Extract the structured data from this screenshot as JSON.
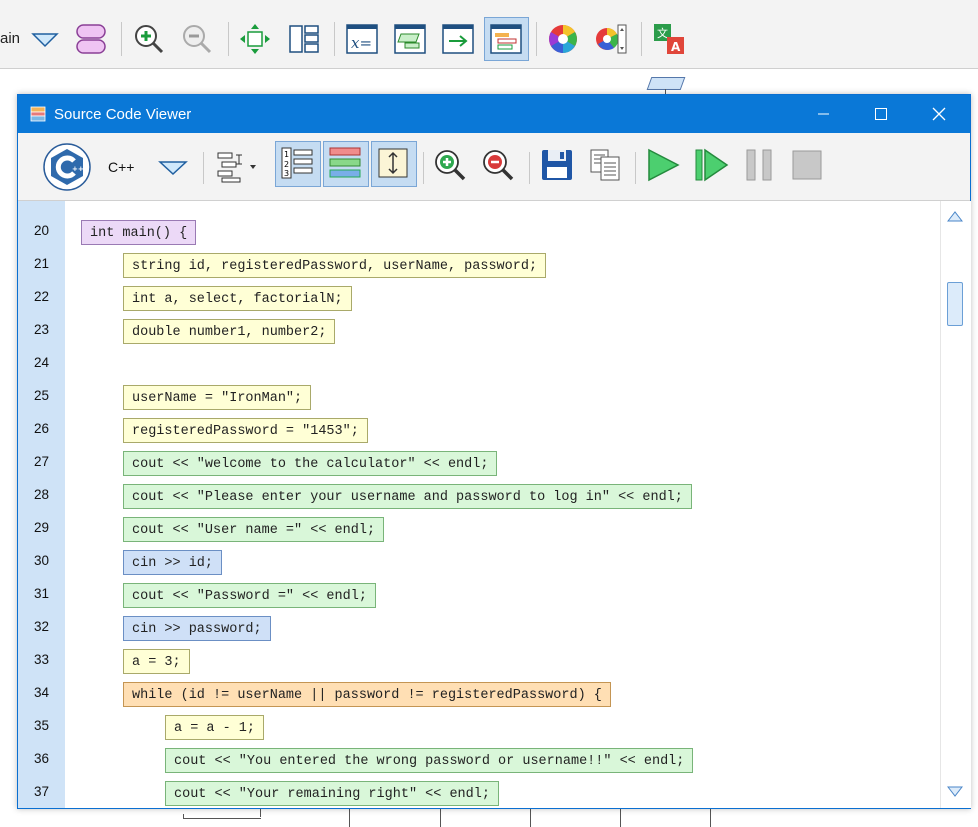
{
  "background": {
    "toolbar_label": "ain",
    "icons": [
      "dropdown-arrow-icon",
      "shape-icon",
      "zoom-in-icon",
      "zoom-out-icon",
      "fit-icon",
      "layout-icon",
      "variable-icon",
      "process-icon",
      "output-icon",
      "code-view-icon",
      "color-wheel-icon",
      "color-picker-icon",
      "translate-icon"
    ]
  },
  "window": {
    "title": "Source Code Viewer",
    "language": "C++"
  },
  "code": {
    "line_numbers": [
      "20",
      "21",
      "22",
      "23",
      "24",
      "25",
      "26",
      "27",
      "28",
      "29",
      "30",
      "31",
      "32",
      "33",
      "34",
      "35",
      "36",
      "37"
    ],
    "lines": [
      "int main() {",
      "string id, registeredPassword, userName, password;",
      "int a, select, factorialN;",
      "double number1, number2;",
      "userName = \"IronMan\";",
      "registeredPassword = \"1453\";",
      "cout << \"welcome to the calculator\" << endl;",
      "cout << \"Please enter your username and password to log in\" << endl;",
      "cout << \"User name =\" << endl;",
      "cin >> id;",
      "cout << \"Password =\" << endl;",
      "cin >> password;",
      "a = 3;",
      "while (id != userName || password != registeredPassword) {",
      "a = a - 1;",
      "cout << \"You entered the wrong password or username!!\" << endl;",
      "cout << \"Your remaining right\" << endl;"
    ]
  },
  "colors": {
    "titlebar": "#0a78d7",
    "gutter": "#cfe3f7",
    "declaration": "#ffffd6",
    "output": "#d9f7d9",
    "input": "#cfe0f7",
    "function": "#ecd9f7",
    "loop": "#ffdfb4"
  }
}
